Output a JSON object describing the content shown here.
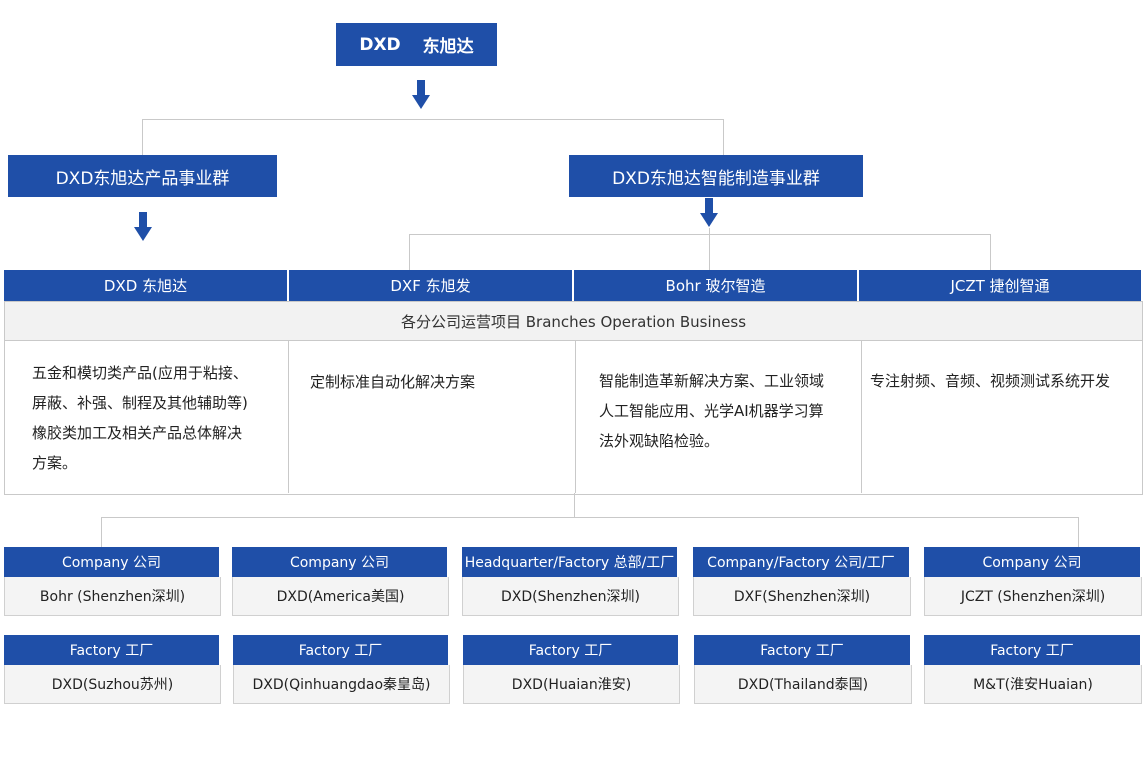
{
  "top": {
    "label_en": "DXD",
    "label_cn": "东旭达"
  },
  "groups": {
    "product": "DXD东旭达产品事业群",
    "manufacturing": "DXD东旭达智能制造事业群"
  },
  "brands": [
    {
      "label": "DXD 东旭达"
    },
    {
      "label": "DXF 东旭发"
    },
    {
      "label": "Bohr 玻尔智造"
    },
    {
      "label": "JCZT 捷创智通"
    }
  ],
  "branches": {
    "title": "各分公司运营项目  Branches Operation Business",
    "descriptions": [
      {
        "line1": "五金和模切类产品(应用于粘接、",
        "line2": "屏蔽、补强、制程及其他辅助等)",
        "line3": "橡胶类加工及相关产品总体解决",
        "line4": "方案。"
      },
      {
        "line1": "定制标准自动化解决方案"
      },
      {
        "line1": "智能制造革新解决方案、工业领域",
        "line2": "人工智能应用、光学AI机器学习算",
        "line3": "法外观缺陷检验。"
      },
      {
        "line1": "专注射频、音频、视频测试系统开发"
      }
    ]
  },
  "locations_row1": [
    {
      "type": "Company 公司",
      "name": "Bohr (Shenzhen深圳)"
    },
    {
      "type": "Company 公司",
      "name": "DXD(America美国)"
    },
    {
      "type": "Headquarter/Factory 总部/工厂",
      "name": "DXD(Shenzhen深圳)"
    },
    {
      "type": "Company/Factory 公司/工厂",
      "name": "DXF(Shenzhen深圳)"
    },
    {
      "type": "Company 公司",
      "name": "JCZT (Shenzhen深圳)"
    }
  ],
  "locations_row2": [
    {
      "type": "Factory 工厂",
      "name": "DXD(Suzhou苏州)"
    },
    {
      "type": "Factory 工厂",
      "name": "DXD(Qinhuangdao秦皇岛)"
    },
    {
      "type": "Factory 工厂",
      "name": "DXD(Huaian淮安)"
    },
    {
      "type": "Factory 工厂",
      "name": "DXD(Thailand泰国)"
    },
    {
      "type": "Factory 工厂",
      "name": "M&T(淮安Huaian)"
    }
  ],
  "colors": {
    "primary": "#1f4fa8",
    "line": "#c9c9c9",
    "panel": "#f2f2f2"
  }
}
